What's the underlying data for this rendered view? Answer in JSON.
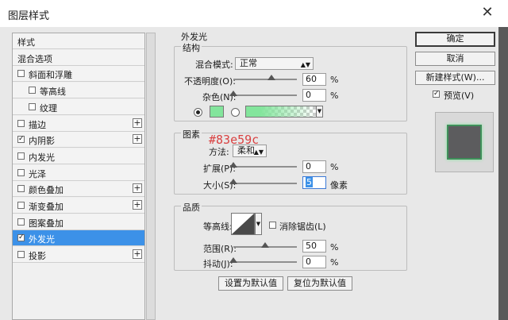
{
  "window": {
    "title": "图层样式",
    "close_glyph": "✕"
  },
  "left_panel": {
    "items": [
      {
        "label": "样式",
        "checkbox": false,
        "checked": false,
        "plus": false,
        "selected": false,
        "indent": 0
      },
      {
        "label": "混合选项",
        "checkbox": false,
        "checked": false,
        "plus": false,
        "selected": false,
        "indent": 0
      },
      {
        "label": "斜面和浮雕",
        "checkbox": true,
        "checked": false,
        "plus": false,
        "selected": false,
        "indent": 0
      },
      {
        "label": "等高线",
        "checkbox": true,
        "checked": false,
        "plus": false,
        "selected": false,
        "indent": 1
      },
      {
        "label": "纹理",
        "checkbox": true,
        "checked": false,
        "plus": false,
        "selected": false,
        "indent": 1
      },
      {
        "label": "描边",
        "checkbox": true,
        "checked": false,
        "plus": true,
        "selected": false,
        "indent": 0
      },
      {
        "label": "内阴影",
        "checkbox": true,
        "checked": true,
        "plus": true,
        "selected": false,
        "indent": 0
      },
      {
        "label": "内发光",
        "checkbox": true,
        "checked": false,
        "plus": false,
        "selected": false,
        "indent": 0
      },
      {
        "label": "光泽",
        "checkbox": true,
        "checked": false,
        "plus": false,
        "selected": false,
        "indent": 0
      },
      {
        "label": "颜色叠加",
        "checkbox": true,
        "checked": false,
        "plus": true,
        "selected": false,
        "indent": 0
      },
      {
        "label": "渐变叠加",
        "checkbox": true,
        "checked": false,
        "plus": true,
        "selected": false,
        "indent": 0
      },
      {
        "label": "图案叠加",
        "checkbox": true,
        "checked": false,
        "plus": false,
        "selected": false,
        "indent": 0
      },
      {
        "label": "外发光",
        "checkbox": true,
        "checked": true,
        "plus": false,
        "selected": true,
        "indent": 0
      },
      {
        "label": "投影",
        "checkbox": true,
        "checked": false,
        "plus": true,
        "selected": false,
        "indent": 0
      }
    ]
  },
  "outer_glow": {
    "title": "外发光",
    "structure": {
      "title": "结构",
      "blend_mode_label": "混合模式:",
      "blend_mode_value": "正常",
      "opacity_label": "不透明度(O):",
      "opacity_value": "60",
      "opacity_unit": "%",
      "noise_label": "杂色(N):",
      "noise_value": "0",
      "noise_unit": "%",
      "glow_color": "#83e59c",
      "gradient_start": "#83e59c"
    },
    "elements": {
      "title": "图素",
      "annotation": "#83e59c",
      "technique_label": "方法:",
      "technique_value": "柔和",
      "spread_label": "扩展(P):",
      "spread_value": "0",
      "spread_unit": "%",
      "size_label": "大小(S):",
      "size_value": "5",
      "size_unit": "像素"
    },
    "quality": {
      "title": "品质",
      "contour_label": "等高线:",
      "antialias_label": "消除锯齿(L)",
      "range_label": "范围(R):",
      "range_value": "50",
      "range_unit": "%",
      "jitter_label": "抖动(J):",
      "jitter_value": "0",
      "jitter_unit": "%"
    },
    "buttons": {
      "make_default": "设置为默认值",
      "reset_default": "复位为默认值"
    }
  },
  "right_panel": {
    "ok": "确定",
    "cancel": "取消",
    "new_style": "新建样式(W)...",
    "preview_label": "预览(V)",
    "preview_checked": true
  },
  "colors": {
    "selection": "#3c91e8",
    "glow": "#83e59c",
    "annotation": "#d94141"
  }
}
